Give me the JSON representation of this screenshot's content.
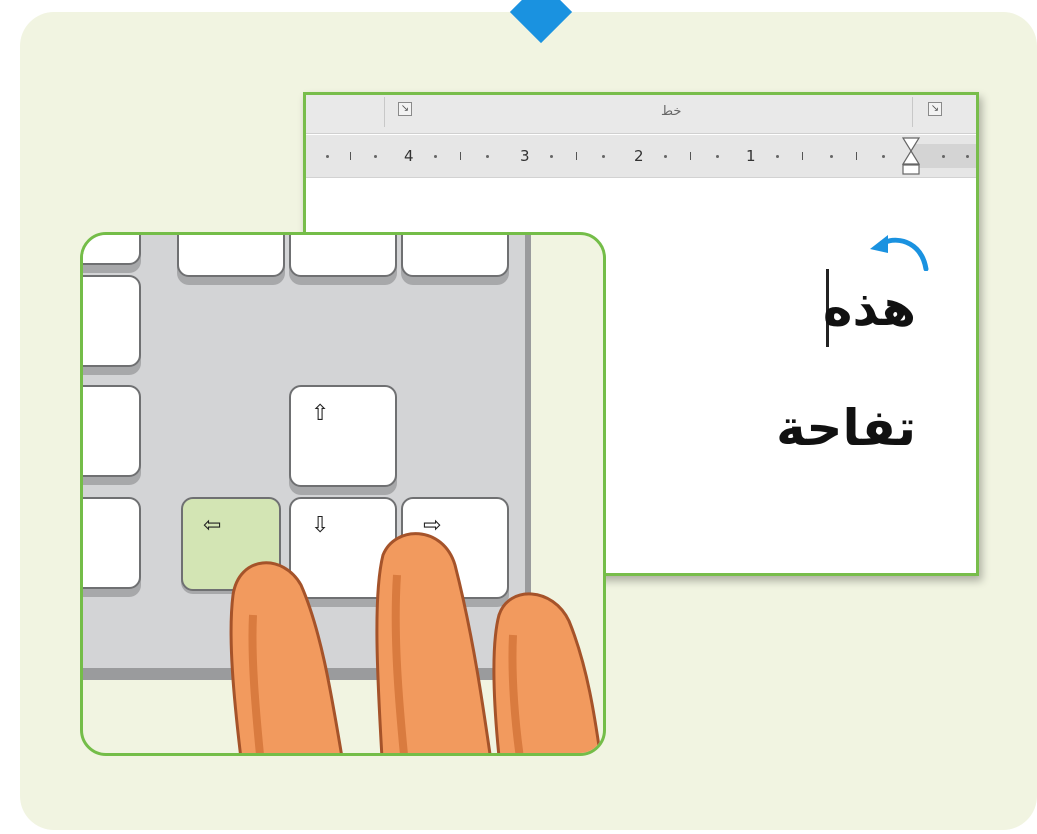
{
  "ribbon": {
    "group_label": "خط",
    "launcher_glyph": "↘"
  },
  "ruler": {
    "numbers": [
      "4",
      "3",
      "2",
      "1"
    ]
  },
  "document": {
    "word_1": "هذه",
    "word_2": "تفاحة"
  },
  "keys": {
    "up": "⇧",
    "down": "⇩",
    "left": "⇦",
    "right": "⇨"
  },
  "colors": {
    "accent_green": "#78bd4b",
    "marker_blue": "#1a92e0",
    "finger_orange": "#f29a5e",
    "pressed_key": "#d3e5b4"
  }
}
